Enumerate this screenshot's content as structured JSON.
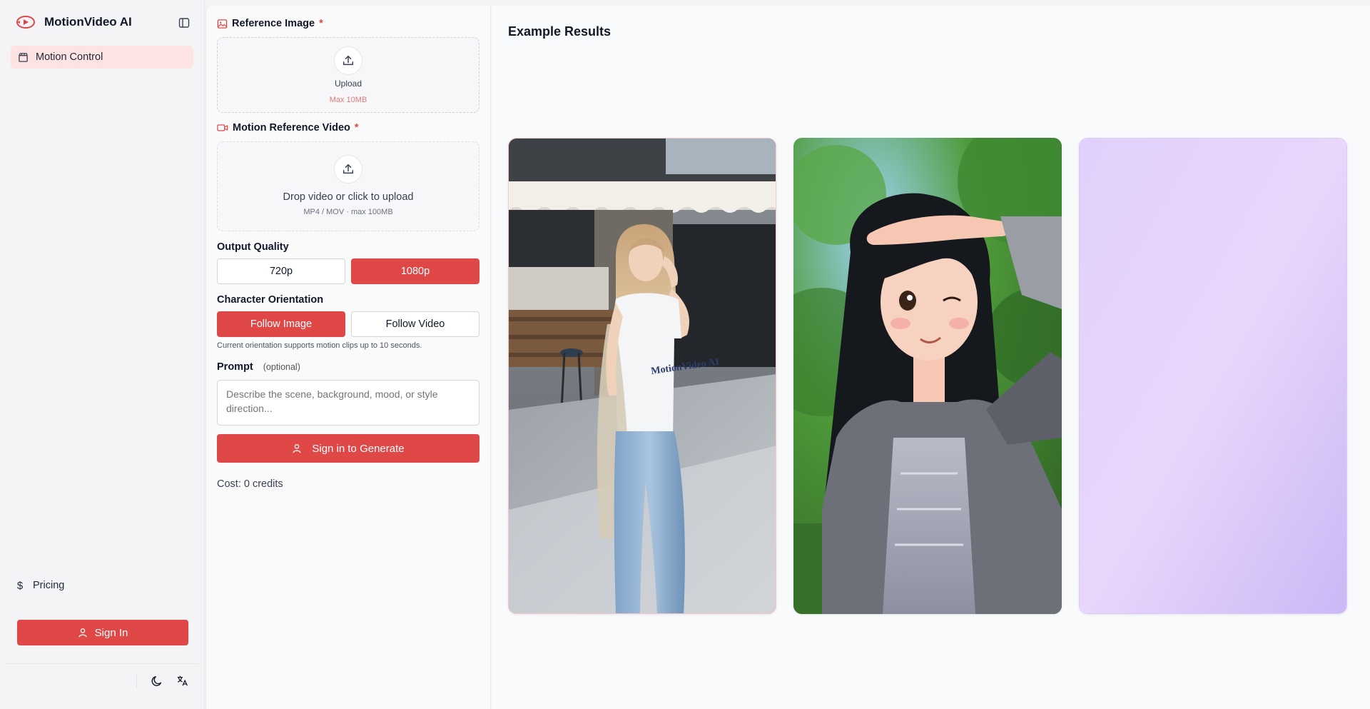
{
  "brand": {
    "name": "MotionVideo AI"
  },
  "sidebar": {
    "items": [
      {
        "label": "Motion Control",
        "icon": "clapperboard-icon",
        "active": true
      }
    ],
    "pricing_label": "Pricing",
    "signin_label": "Sign In"
  },
  "form": {
    "reference_image": {
      "label": "Reference Image",
      "required_mark": "*",
      "upload_label": "Upload",
      "limit": "Max 10MB"
    },
    "motion_video": {
      "label": "Motion Reference Video",
      "required_mark": "*",
      "drop_text": "Drop video or click to upload",
      "formats": "MP4 / MOV · max 100MB"
    },
    "output_quality": {
      "label": "Output Quality",
      "options": [
        "720p",
        "1080p"
      ],
      "selected": "1080p"
    },
    "orientation": {
      "label": "Character Orientation",
      "options": [
        "Follow Image",
        "Follow Video"
      ],
      "selected": "Follow Image",
      "hint": "Current orientation supports motion clips up to 10 seconds."
    },
    "prompt": {
      "label": "Prompt",
      "optional": "(optional)",
      "placeholder": "Describe the scene, background, mood, or style direction..."
    },
    "generate_label": "Sign in to Generate",
    "cost": "Cost: 0 credits"
  },
  "results": {
    "title": "Example Results",
    "cards": [
      {
        "subject": "photo-woman-street",
        "shirt_text": "MotionVideo AI"
      },
      {
        "subject": "cartoon-girl-saluting"
      },
      {
        "subject": "lavender-placeholder"
      }
    ]
  },
  "colors": {
    "accent": "#e04848",
    "accent_soft": "#fde3e1",
    "lavender": "#d8c8fb"
  }
}
